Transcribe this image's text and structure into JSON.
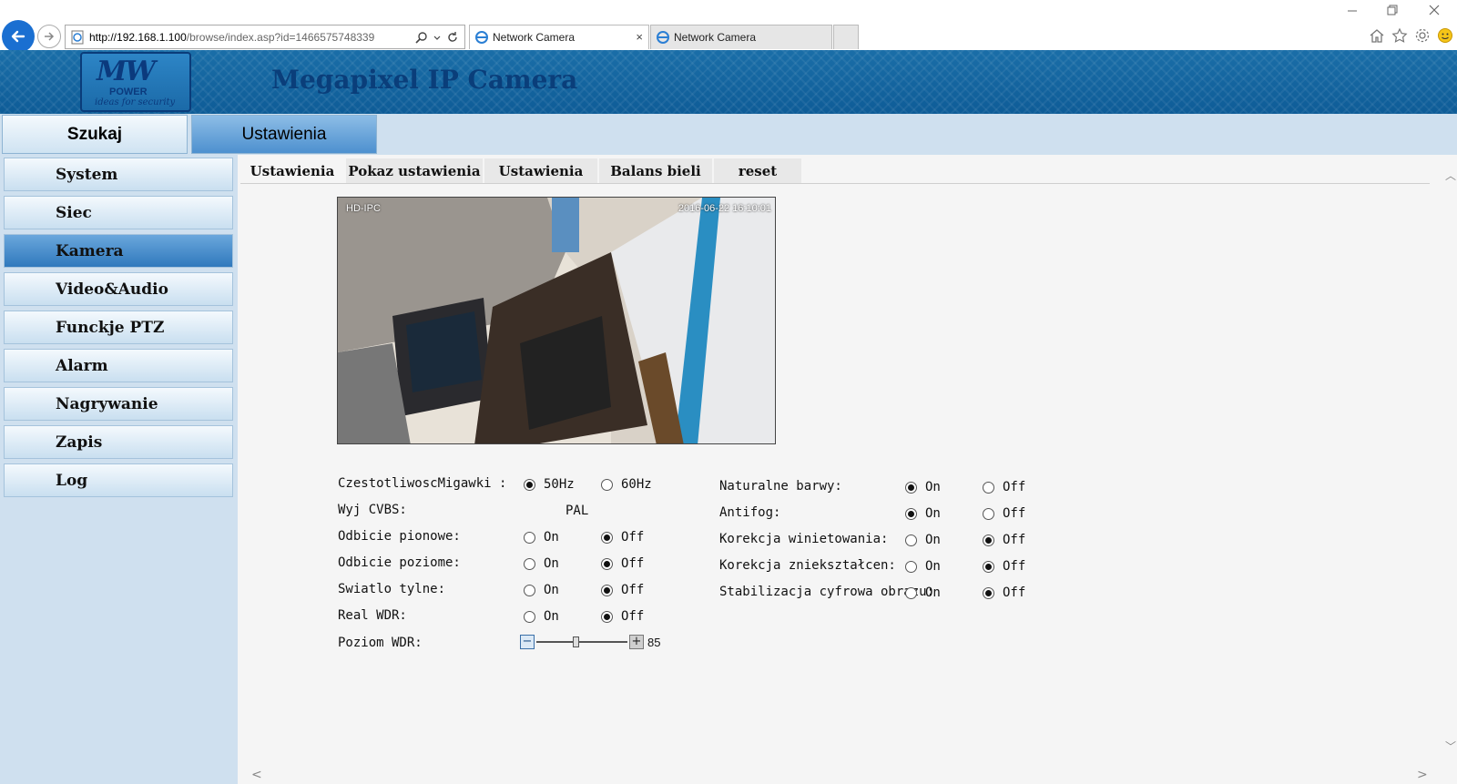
{
  "browser": {
    "url_host": "http://192.168.1.100",
    "url_rest": "/browse/index.asp?id=1466575748339",
    "tabs": [
      {
        "title": "Network Camera",
        "close": "×"
      },
      {
        "title": "Network Camera"
      }
    ]
  },
  "header": {
    "logo_mw": "MW",
    "logo_power": "POWER",
    "logo_slogan": "ideas for security",
    "title": "Megapixel IP Camera"
  },
  "top_tabs": {
    "search": "Szukaj",
    "settings": "Ustawienia"
  },
  "sidebar": {
    "items": [
      {
        "label": "System"
      },
      {
        "label": "Siec"
      },
      {
        "label": "Kamera"
      },
      {
        "label": "Video&Audio"
      },
      {
        "label": "Funckje PTZ"
      },
      {
        "label": "Alarm"
      },
      {
        "label": "Nagrywanie"
      },
      {
        "label": "Zapis"
      },
      {
        "label": "Log"
      }
    ],
    "active_index": 2
  },
  "subtabs": [
    "Ustawienia",
    "Pokaz ustawienia",
    "Ustawienia",
    "Balans bieli",
    "reset"
  ],
  "preview": {
    "osd_name": "HD-IPC",
    "osd_time": "2016-06-22 16:10:01"
  },
  "settings_left": {
    "shutter": {
      "label": "CzestotliwoscMigawki :",
      "opt1": "50Hz",
      "opt2": "60Hz",
      "selected": "50Hz"
    },
    "cvbs": {
      "label": "Wyj CVBS:",
      "value": "PAL"
    },
    "vflip": {
      "label": "Odbicie pionowe:",
      "on": "On",
      "off": "Off",
      "selected": "Off"
    },
    "hflip": {
      "label": "Odbicie poziome:",
      "on": "On",
      "off": "Off",
      "selected": "Off"
    },
    "backlight": {
      "label": "Swiatlo tylne:",
      "on": "On",
      "off": "Off",
      "selected": "Off"
    },
    "wdr": {
      "label": "Real WDR:",
      "on": "On",
      "off": "Off",
      "selected": "Off"
    },
    "wdr_level": {
      "label": "Poziom WDR:",
      "value": "85",
      "minus": "−",
      "plus": "+",
      "fraction": 0.43
    }
  },
  "settings_right": {
    "natural": {
      "label": "Naturalne barwy:",
      "on": "On",
      "off": "Off",
      "selected": "On"
    },
    "antifog": {
      "label": "Antifog:",
      "on": "On",
      "off": "Off",
      "selected": "On"
    },
    "vignette": {
      "label": "Korekcja winietowania:",
      "on": "On",
      "off": "Off",
      "selected": "Off"
    },
    "distortion": {
      "label": "Korekcja zniekształcen:",
      "on": "On",
      "off": "Off",
      "selected": "Off"
    },
    "stabil": {
      "label": "Stabilizacja cyfrowa obrazu:",
      "on": "On",
      "off": "Off",
      "selected": "Off"
    }
  },
  "colors": {
    "banner": "#0e5c97",
    "sidebar_bg": "#cfe0ef",
    "active_item": "#3079bd"
  }
}
